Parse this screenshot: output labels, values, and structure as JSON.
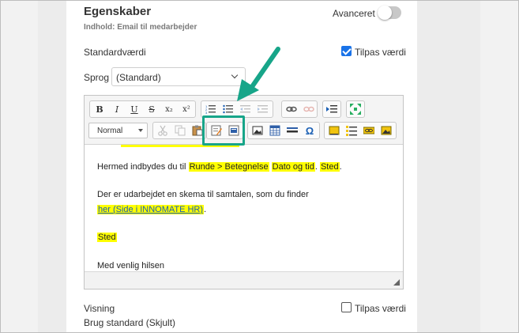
{
  "header": {
    "title": "Egenskaber",
    "subtitle": "Indhold: Email til medarbejder",
    "advanced_label": "Avanceret"
  },
  "default_value": {
    "label": "Standardværdi",
    "customize_label": "Tilpas værdi",
    "customize_checked": true
  },
  "language": {
    "label": "Sprog",
    "selected": "(Standard)"
  },
  "toolbar": {
    "row1": {
      "bold": "B",
      "italic": "I",
      "underline": "U",
      "strike": "S",
      "subscript": "x₂",
      "superscript": "x²"
    },
    "format_selected": "Normal"
  },
  "editor_content": {
    "line1_prefix": "Hermed indbydes du til",
    "field1": "Runde > Betegnelse",
    "field2": "Dato og tid",
    "sep": ".",
    "field3": "Sted",
    "end": ".",
    "line2": "Der er udarbejdet en skema til samtalen, som du finder",
    "link": "her (Side i INNOMATE HR)",
    "link_end": ".",
    "field4": "Sted",
    "closing": "Med venlig hilsen"
  },
  "visibility": {
    "label": "Visning",
    "customize_label": "Tilpas værdi",
    "customize_checked": false,
    "value": "Brug standard (Skjult)"
  },
  "colors": {
    "highlight": "#ffff00",
    "annotation": "#17a589",
    "checkbox": "#1a73e8"
  }
}
